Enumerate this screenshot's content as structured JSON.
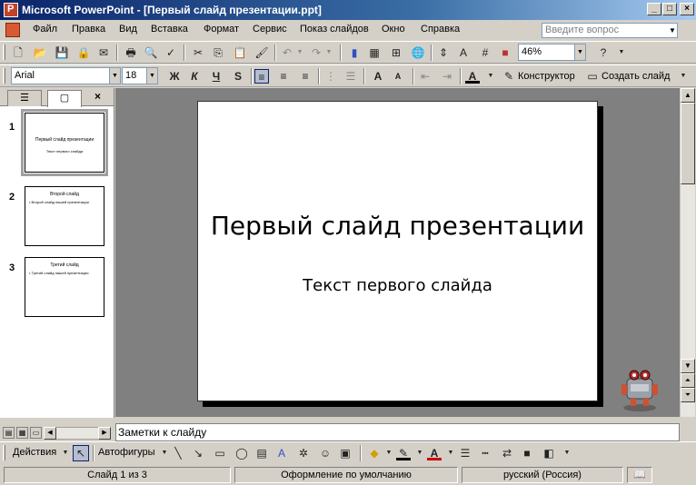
{
  "window": {
    "title": "Microsoft PowerPoint - [Первый слайд презентации.ppt]"
  },
  "menu": {
    "items": [
      "Файл",
      "Правка",
      "Вид",
      "Вставка",
      "Формат",
      "Сервис",
      "Показ слайдов",
      "Окно",
      "Справка"
    ],
    "help_placeholder": "Введите вопрос"
  },
  "standard_toolbar": {
    "zoom": "46%"
  },
  "formatting_toolbar": {
    "font": "Arial",
    "size": "18",
    "bold": "Ж",
    "italic": "К",
    "underline": "Ч",
    "shadow": "S",
    "designer": "Конструктор",
    "new_slide": "Создать слайд"
  },
  "slides": [
    {
      "number": "1",
      "title": "Первый слайд презентации",
      "body": "Текст первого слайда",
      "selected": true
    },
    {
      "number": "2",
      "title": "Второй слайд",
      "body": "• Второй слайд нашей презентации",
      "selected": false
    },
    {
      "number": "3",
      "title": "Третий слайд",
      "body": "• Третий слайд нашей презентации",
      "selected": false
    }
  ],
  "current_slide": {
    "title": "Первый слайд презентации",
    "subtitle": "Текст первого слайда"
  },
  "notes": {
    "text": "Заметки к слайду"
  },
  "drawing_toolbar": {
    "actions": "Действия",
    "autoshapes": "Автофигуры"
  },
  "status": {
    "slide": "Слайд 1 из 3",
    "design": "Оформление по умолчанию",
    "language": "русский (Россия)"
  }
}
